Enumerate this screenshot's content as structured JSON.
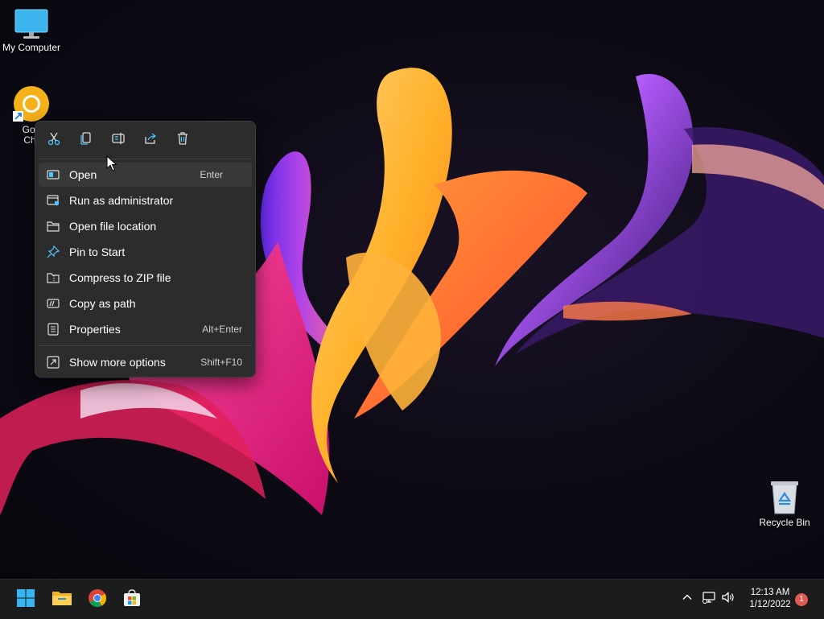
{
  "desktop": {
    "icons": [
      {
        "label": "My Computer",
        "icon": "monitor-icon"
      },
      {
        "label": "Goo",
        "label2": "Chr",
        "icon": "chrome-canary-icon"
      },
      {
        "label": "Recycle Bin",
        "icon": "recycle-bin-icon"
      }
    ]
  },
  "context_menu": {
    "toolbar": [
      {
        "icon": "cut-icon"
      },
      {
        "icon": "copy-icon"
      },
      {
        "icon": "rename-icon"
      },
      {
        "icon": "share-icon"
      },
      {
        "icon": "delete-icon"
      }
    ],
    "items": [
      {
        "label": "Open",
        "shortcut": "Enter",
        "icon": "open-icon"
      },
      {
        "label": "Run as administrator",
        "shortcut": "",
        "icon": "run-as-admin-icon"
      },
      {
        "label": "Open file location",
        "shortcut": "",
        "icon": "folder-icon"
      },
      {
        "label": "Pin to Start",
        "shortcut": "",
        "icon": "pin-icon"
      },
      {
        "label": "Compress to ZIP file",
        "shortcut": "",
        "icon": "zip-folder-icon"
      },
      {
        "label": "Copy as path",
        "shortcut": "",
        "icon": "copy-path-icon"
      },
      {
        "label": "Properties",
        "shortcut": "Alt+Enter",
        "icon": "properties-icon"
      },
      {
        "label": "Show more options",
        "shortcut": "Shift+F10",
        "icon": "more-options-icon"
      }
    ]
  },
  "taskbar": {
    "apps": [
      {
        "icon": "windows-start-icon"
      },
      {
        "icon": "file-explorer-icon"
      },
      {
        "icon": "chrome-icon"
      },
      {
        "icon": "microsoft-store-icon"
      }
    ],
    "tray": [
      {
        "icon": "chevron-up-icon"
      },
      {
        "icon": "network-icon"
      },
      {
        "icon": "volume-icon"
      }
    ],
    "time": "12:13 AM",
    "date": "1/12/2022",
    "notification_count": "1"
  },
  "colors": {
    "menu_bg": "#2c2c2c",
    "taskbar_bg": "#1c1c1c",
    "accent": "#4cc2ff"
  }
}
